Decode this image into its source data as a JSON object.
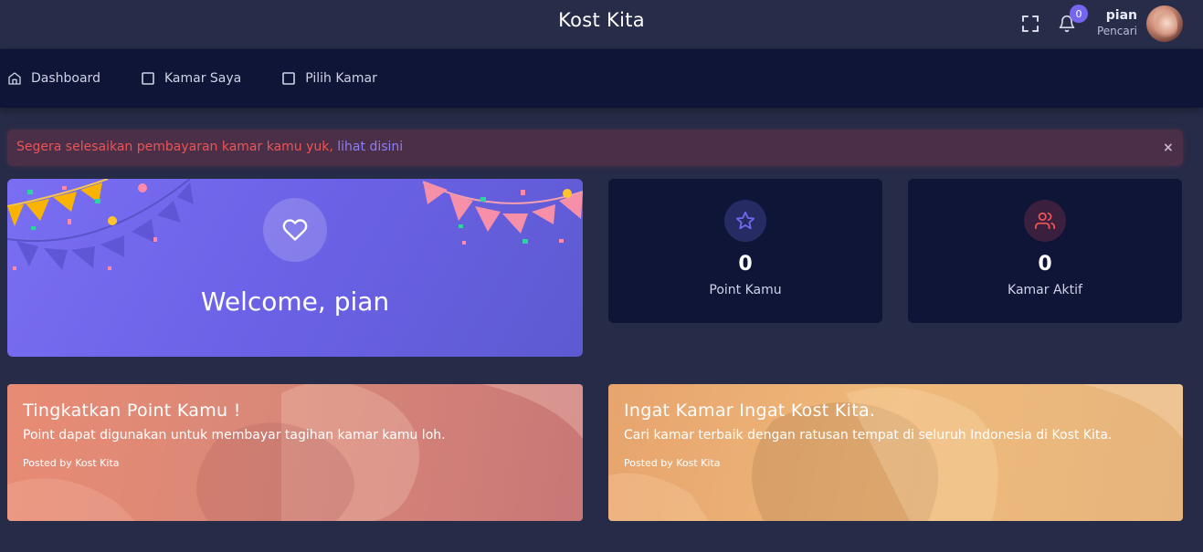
{
  "header": {
    "brand": "Kost Kita",
    "notification_count": "0",
    "user_name": "pian",
    "user_role": "Pencari"
  },
  "nav": {
    "items": [
      {
        "label": "Dashboard",
        "icon": "home-icon"
      },
      {
        "label": "Kamar Saya",
        "icon": "square-icon"
      },
      {
        "label": "Pilih Kamar",
        "icon": "square-icon"
      }
    ]
  },
  "alert": {
    "message": "Segera selesaikan pembayaran kamar kamu yuk, ",
    "link": "lihat disini",
    "close": "×"
  },
  "welcome": {
    "text": "Welcome, pian",
    "icon": "heart-icon"
  },
  "stats": [
    {
      "value": "0",
      "label": "Point Kamu",
      "icon": "star-icon",
      "color": "#7367f0"
    },
    {
      "value": "0",
      "label": "Kamar Aktif",
      "icon": "users-icon",
      "color": "#ea5455"
    }
  ],
  "cards": [
    {
      "title": "Tingkatkan Point Kamu !",
      "subtitle": "Point dapat digunakan untuk membayar tagihan kamar kamu loh.",
      "meta": "Posted by Kost Kita"
    },
    {
      "title": "Ingat Kamar Ingat Kost Kita.",
      "subtitle": "Cari kamar terbaik dengan ratusan tempat di seluruh Indonesia di Kost Kita.",
      "meta": "Posted by Kost Kita"
    }
  ],
  "colors": {
    "accent": "#7367f0",
    "danger": "#ea5455",
    "card_bg": "#0f1537",
    "page_bg": "#262b47"
  }
}
